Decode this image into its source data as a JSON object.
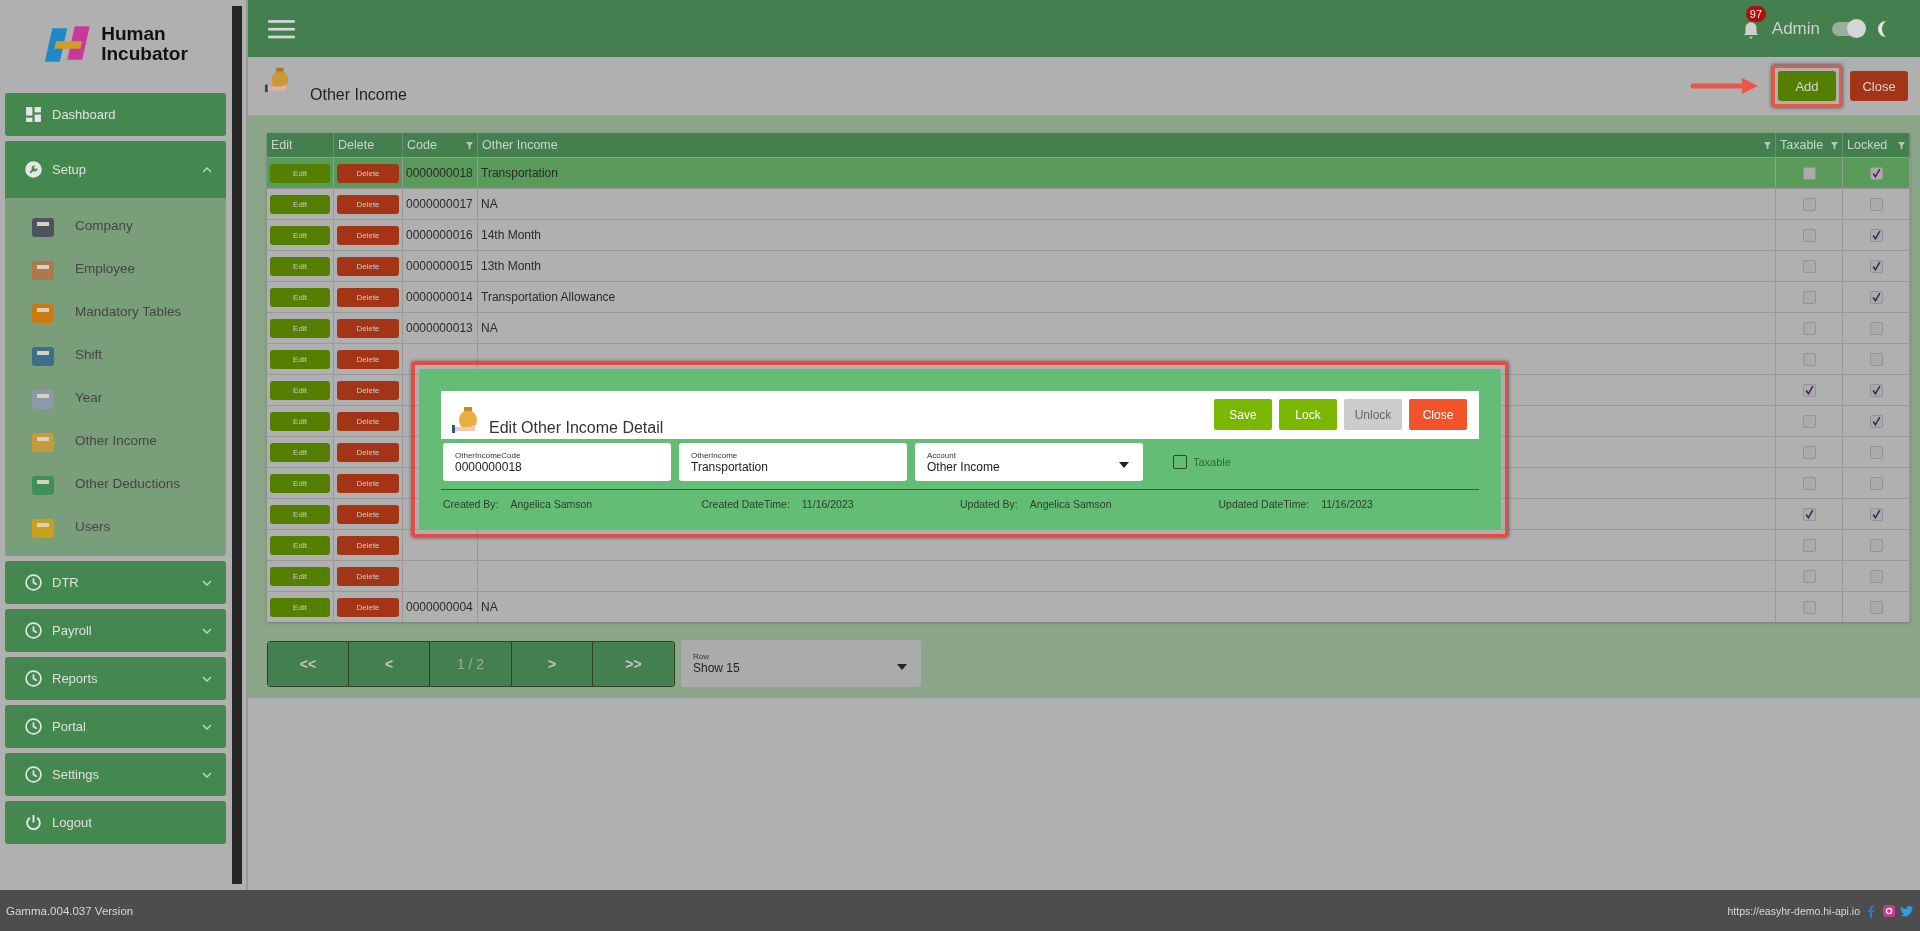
{
  "sidebar": {
    "logo_line_1": "Human",
    "logo_line_2": "Incubator",
    "items": [
      {
        "label": "Dashboard",
        "kind": "link"
      },
      {
        "label": "Setup",
        "kind": "group",
        "expanded": true,
        "children": [
          {
            "label": "Company"
          },
          {
            "label": "Employee"
          },
          {
            "label": "Mandatory Tables"
          },
          {
            "label": "Shift"
          },
          {
            "label": "Year"
          },
          {
            "label": "Other Income"
          },
          {
            "label": "Other Deductions"
          },
          {
            "label": "Users"
          }
        ]
      },
      {
        "label": "DTR",
        "kind": "group",
        "expanded": false
      },
      {
        "label": "Payroll",
        "kind": "group",
        "expanded": false
      },
      {
        "label": "Reports",
        "kind": "group",
        "expanded": false
      },
      {
        "label": "Portal",
        "kind": "group",
        "expanded": false
      },
      {
        "label": "Settings",
        "kind": "group",
        "expanded": false
      },
      {
        "label": "Logout",
        "kind": "link"
      }
    ]
  },
  "header": {
    "notification_count": "97",
    "user": "Admin",
    "theme_toggle": {
      "on": true
    }
  },
  "page": {
    "title": "Other Income",
    "add_button": "Add",
    "close_button": "Close"
  },
  "table": {
    "columns": [
      {
        "label": "Edit",
        "filterable": false
      },
      {
        "label": "Delete",
        "filterable": false
      },
      {
        "label": "Code",
        "filterable": true
      },
      {
        "label": "Other Income",
        "filterable": true
      },
      {
        "label": "Taxable",
        "filterable": true
      },
      {
        "label": "Locked",
        "filterable": true
      }
    ],
    "rows": [
      {
        "edit": "Edit",
        "delete": "Delete",
        "code": "0000000018",
        "name": "Transportation",
        "taxable": false,
        "locked": true,
        "selected": true
      },
      {
        "edit": "Edit",
        "delete": "Delete",
        "code": "0000000017",
        "name": "NA",
        "taxable": false,
        "locked": false,
        "selected": false
      },
      {
        "edit": "Edit",
        "delete": "Delete",
        "code": "0000000016",
        "name": "14th Month",
        "taxable": false,
        "locked": true,
        "selected": false
      },
      {
        "edit": "Edit",
        "delete": "Delete",
        "code": "0000000015",
        "name": "13th Month",
        "taxable": false,
        "locked": true,
        "selected": false
      },
      {
        "edit": "Edit",
        "delete": "Delete",
        "code": "0000000014",
        "name": "Transportation Allowance",
        "taxable": false,
        "locked": true,
        "selected": false
      },
      {
        "edit": "Edit",
        "delete": "Delete",
        "code": "0000000013",
        "name": "NA",
        "taxable": false,
        "locked": false,
        "selected": false
      },
      {
        "edit": "Edit",
        "delete": "Delete",
        "taxable": false,
        "locked": false,
        "selected": false
      },
      {
        "edit": "Edit",
        "delete": "Delete",
        "taxable": true,
        "locked": true,
        "selected": false
      },
      {
        "edit": "Edit",
        "delete": "Delete",
        "taxable": false,
        "locked": true,
        "selected": false
      },
      {
        "edit": "Edit",
        "delete": "Delete",
        "taxable": false,
        "locked": false,
        "selected": false
      },
      {
        "edit": "Edit",
        "delete": "Delete",
        "taxable": false,
        "locked": false,
        "selected": false
      },
      {
        "edit": "Edit",
        "delete": "Delete",
        "taxable": true,
        "locked": true,
        "selected": false
      },
      {
        "edit": "Edit",
        "delete": "Delete",
        "taxable": false,
        "locked": false,
        "selected": false
      },
      {
        "edit": "Edit",
        "delete": "Delete",
        "taxable": false,
        "locked": false,
        "selected": false
      },
      {
        "edit": "Edit",
        "delete": "Delete",
        "code": "0000000004",
        "name": "NA",
        "taxable": false,
        "locked": false,
        "selected": false
      }
    ]
  },
  "pagination": {
    "first": "<<",
    "previous": "<",
    "page": "1 / 2",
    "next": ">",
    "last": ">>"
  },
  "row_select": {
    "label": "Row",
    "value": "Show 15"
  },
  "modal": {
    "title": "Edit Other Income Detail",
    "buttons": [
      {
        "label": "Save",
        "kind": "primary",
        "disabled": false
      },
      {
        "label": "Lock",
        "kind": "primary",
        "disabled": false
      },
      {
        "label": "Unlock",
        "kind": "primary",
        "disabled": true
      },
      {
        "label": "Close",
        "kind": "danger",
        "disabled": false
      }
    ],
    "fields": [
      {
        "label": "OtherIncomeCode",
        "value": "0000000018",
        "kind": "text"
      },
      {
        "label": "OtherIncome",
        "value": "Transportation",
        "kind": "text"
      },
      {
        "label": "Account",
        "value": "Other Income",
        "kind": "select"
      }
    ],
    "taxable": {
      "label": "Taxable",
      "checked": false,
      "disabled": true
    },
    "meta": [
      {
        "label": "Created By:",
        "value": "Angelica Samson"
      },
      {
        "label": "Created DateTime:",
        "value": "11/16/2023"
      },
      {
        "label": "Updated By:",
        "value": "Angelica Samson"
      },
      {
        "label": "Updated DateTime:",
        "value": "11/16/2023"
      }
    ]
  },
  "footer": {
    "version": "Gamma.004.037 Version",
    "url": "https://easyhr-demo.hi-api.io"
  }
}
